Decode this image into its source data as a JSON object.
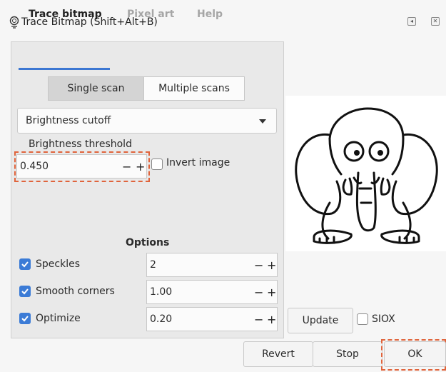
{
  "window": {
    "title": "Trace Bitmap (Shift+Alt+B)"
  },
  "tabs": [
    {
      "label": "Trace bitmap",
      "active": true
    },
    {
      "label": "Pixel art",
      "active": false
    },
    {
      "label": "Help",
      "active": false
    }
  ],
  "scan_modes": {
    "single": "Single scan",
    "multiple": "Multiple scans",
    "selected": "Single scan"
  },
  "detection_mode": {
    "value": "Brightness cutoff"
  },
  "threshold": {
    "label": "Brightness threshold",
    "value": "0.450",
    "minus": "−",
    "plus": "+",
    "invert_label": "Invert image",
    "invert_checked": false
  },
  "options": {
    "heading": "Options",
    "rows": [
      {
        "label": "Speckles",
        "checked": true,
        "value": "2"
      },
      {
        "label": "Smooth corners",
        "checked": true,
        "value": "1.00"
      },
      {
        "label": "Optimize",
        "checked": true,
        "value": "0.20"
      }
    ]
  },
  "preview": {
    "update_label": "Update",
    "siox_label": "SIOX",
    "siox_checked": false,
    "image": "elephant-line-art"
  },
  "footer": {
    "revert_label": "Revert",
    "stop_label": "Stop",
    "ok_label": "OK"
  },
  "colors": {
    "accent": "#3b7bd6",
    "highlight": "#e0643c"
  }
}
